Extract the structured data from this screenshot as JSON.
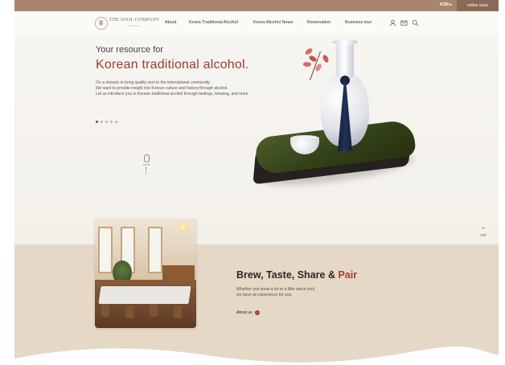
{
  "topbar": {
    "language": "KOR ▸",
    "online_class": "online class"
  },
  "brand": {
    "name": "THE SOOL COMPANY",
    "tagline": "GANGSE"
  },
  "nav": {
    "about": "About",
    "korea_traditional_alcohol": "Korea Traditional Alcohol",
    "korea_alcohol_news": "Korea Alcohol News",
    "reservation": "Reservation",
    "business_tour": "Business tour"
  },
  "icons": {
    "user": "user-icon",
    "mail": "mail-icon",
    "search": "search-icon"
  },
  "hero": {
    "eyebrow": "Your resource for",
    "title": "Korean traditional alcohol.",
    "desc_line1": "On a mission to bring quality sool to the international community.",
    "desc_line2": "We want to provide insight into Korean culture and history through alcohol.",
    "desc_line3": "Let us introduce you to Korean traditional alcohol through tastings, brewing, and more.",
    "slides_count": 5,
    "active_slide": 1,
    "scroll_label": "scroll"
  },
  "top_button": {
    "label": "TOP"
  },
  "section": {
    "title_main": "Brew, Taste, Share",
    "title_amp": " & ",
    "title_accent": "Pair",
    "desc_line1": "Whether you know a lot or a little about sool,",
    "desc_line2": "we have an experience for you.",
    "link_label": "About us"
  },
  "colors": {
    "topbar": "#a7856f",
    "accent": "#9a3c34",
    "lower_bg": "#e6d8c7"
  }
}
